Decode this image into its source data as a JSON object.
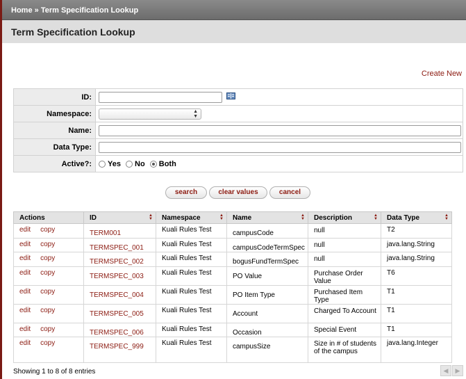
{
  "breadcrumb": {
    "home": "Home",
    "separator": "»",
    "current": "Term Specification Lookup"
  },
  "page_title": "Term Specification Lookup",
  "create_new": "Create New",
  "criteria": {
    "id_label": "ID:",
    "namespace_label": "Namespace:",
    "name_label": "Name:",
    "data_type_label": "Data Type:",
    "active_label": "Active?:",
    "active_options": [
      "Yes",
      "No",
      "Both"
    ],
    "active_selected": "Both"
  },
  "buttons": {
    "search": "search",
    "clear": "clear values",
    "cancel": "cancel"
  },
  "table": {
    "headers": [
      "Actions",
      "ID",
      "Namespace",
      "Name",
      "Description",
      "Data Type"
    ],
    "edit": "edit",
    "copy": "copy",
    "rows": [
      {
        "id": "TERM001",
        "namespace": "Kuali Rules Test",
        "name": "campusCode",
        "description": "null",
        "data_type": "T2"
      },
      {
        "id": "TERMSPEC_001",
        "namespace": "Kuali Rules Test",
        "name": "campusCodeTermSpec",
        "description": "null",
        "data_type": "java.lang.String"
      },
      {
        "id": "TERMSPEC_002",
        "namespace": "Kuali Rules Test",
        "name": "bogusFundTermSpec",
        "description": "null",
        "data_type": "java.lang.String"
      },
      {
        "id": "TERMSPEC_003",
        "namespace": "Kuali Rules Test",
        "name": "PO Value",
        "description": "Purchase Order Value",
        "data_type": "T6"
      },
      {
        "id": "TERMSPEC_004",
        "namespace": "Kuali Rules Test",
        "name": "PO Item Type",
        "description": "Purchased Item Type",
        "data_type": "T1"
      },
      {
        "id": "TERMSPEC_005",
        "namespace": "Kuali Rules Test",
        "name": "Account",
        "description": "Charged To Account",
        "data_type": "T1"
      },
      {
        "id": "TERMSPEC_006",
        "namespace": "Kuali Rules Test",
        "name": "Occasion",
        "description": "Special Event",
        "data_type": "T1"
      },
      {
        "id": "TERMSPEC_999",
        "namespace": "Kuali Rules Test",
        "name": "campusSize",
        "description": "Size in # of students of the campus",
        "data_type": "java.lang.Integer"
      }
    ]
  },
  "footer": "Showing 1 to 8 of 8 entries",
  "colors": {
    "link": "#8b1a10",
    "header_bar": "#777777",
    "accent_bar": "#7a1a14"
  }
}
